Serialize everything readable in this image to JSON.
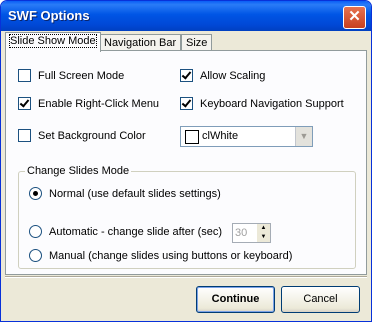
{
  "window": {
    "title": "SWF Options",
    "close_glyph": "✕"
  },
  "tabs": [
    {
      "label": "Slide Show Mode",
      "active": true
    },
    {
      "label": "Navigation Bar",
      "active": false
    },
    {
      "label": "Size",
      "active": false
    }
  ],
  "options": {
    "full_screen": {
      "label": "Full Screen Mode",
      "checked": false
    },
    "right_click": {
      "label": "Enable Right-Click Menu",
      "checked": true
    },
    "set_bg": {
      "label": "Set Background Color",
      "checked": false
    },
    "allow_scaling": {
      "label": "Allow Scaling",
      "checked": true
    },
    "keyboard_nav": {
      "label": "Keyboard Navigation Support",
      "checked": true
    },
    "bg_color": {
      "value": "clWhite",
      "swatch": "#ffffff",
      "dropdown_icon": "chevron-down-icon"
    }
  },
  "change_slides": {
    "legend": "Change Slides Mode",
    "normal": {
      "label": "Normal (use default slides settings)",
      "selected": true
    },
    "automatic": {
      "label": "Automatic - change slide after (sec)",
      "selected": false,
      "seconds": "30"
    },
    "manual": {
      "label": "Manual (change slides using buttons or keyboard)",
      "selected": false
    }
  },
  "buttons": {
    "continue": "Continue",
    "cancel": "Cancel"
  }
}
